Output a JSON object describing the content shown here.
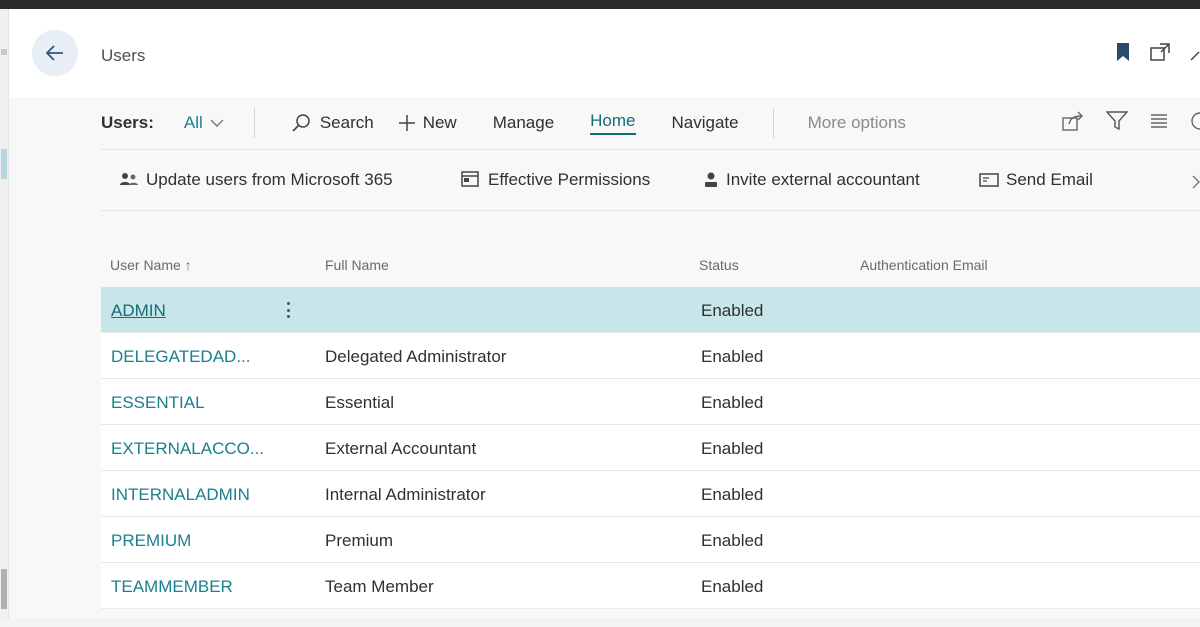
{
  "header": {
    "title": "Users",
    "icons": [
      "back-arrow-icon",
      "bookmark-icon",
      "open-new-window-icon",
      "collapse-icon"
    ]
  },
  "actionbar": {
    "view_label": "Users:",
    "view_value": "All",
    "search": "Search",
    "new": "New",
    "manage": "Manage",
    "home": "Home",
    "navigate": "Navigate",
    "more_options": "More options"
  },
  "subbar": {
    "update_users": "Update users from Microsoft 365",
    "effective_permissions": "Effective Permissions",
    "invite_accountant": "Invite external accountant",
    "send_email": "Send Email"
  },
  "table": {
    "columns": {
      "user_name": "User Name ↑",
      "full_name": "Full Name",
      "status": "Status",
      "auth_email": "Authentication Email"
    },
    "rows": [
      {
        "user": "ADMIN",
        "full": "",
        "status": "Enabled",
        "auth": ""
      },
      {
        "user": "DELEGATEDAD...",
        "full": "Delegated Administrator",
        "status": "Enabled",
        "auth": ""
      },
      {
        "user": "ESSENTIAL",
        "full": "Essential",
        "status": "Enabled",
        "auth": ""
      },
      {
        "user": "EXTERNALACCO...",
        "full": "External Accountant",
        "status": "Enabled",
        "auth": ""
      },
      {
        "user": "INTERNALADMIN",
        "full": "Internal Administrator",
        "status": "Enabled",
        "auth": ""
      },
      {
        "user": "PREMIUM",
        "full": "Premium",
        "status": "Enabled",
        "auth": ""
      },
      {
        "user": "TEAMMEMBER",
        "full": "Team Member",
        "status": "Enabled",
        "auth": ""
      }
    ]
  },
  "colors": {
    "accent": "#0f6e7a",
    "link": "#1b7f8e",
    "selected_row": "#c8e6ea"
  }
}
